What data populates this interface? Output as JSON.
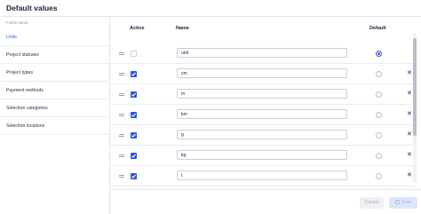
{
  "title": "Default values",
  "sidebar": {
    "header": "Fields name",
    "items": [
      {
        "label": "Units",
        "active": true
      },
      {
        "label": "Project statuses",
        "active": false
      },
      {
        "label": "Project types",
        "active": false
      },
      {
        "label": "Payment methods",
        "active": false
      },
      {
        "label": "Selection categories",
        "active": false
      },
      {
        "label": "Selection locations",
        "active": false
      }
    ]
  },
  "table": {
    "columns": {
      "active": "Active",
      "name": "Name",
      "default": "Default"
    },
    "rows": [
      {
        "name": "unit",
        "active": false,
        "default": true,
        "deletable": false
      },
      {
        "name": "cm",
        "active": true,
        "default": false,
        "deletable": true
      },
      {
        "name": "m",
        "active": true,
        "default": false,
        "deletable": true
      },
      {
        "name": "km",
        "active": true,
        "default": false,
        "deletable": true
      },
      {
        "name": "g",
        "active": true,
        "default": false,
        "deletable": true
      },
      {
        "name": "kg",
        "active": true,
        "default": false,
        "deletable": true
      },
      {
        "name": "t",
        "active": true,
        "default": false,
        "deletable": true
      }
    ],
    "delete_glyph": "✕"
  },
  "footer": {
    "cancel_label": "Cancel",
    "save_label": "Save",
    "save_icon": "floppy-disk-icon"
  },
  "colors": {
    "accent": "#3d5bd9",
    "checkbox": "#2f55d4",
    "text": "#1a2138"
  }
}
